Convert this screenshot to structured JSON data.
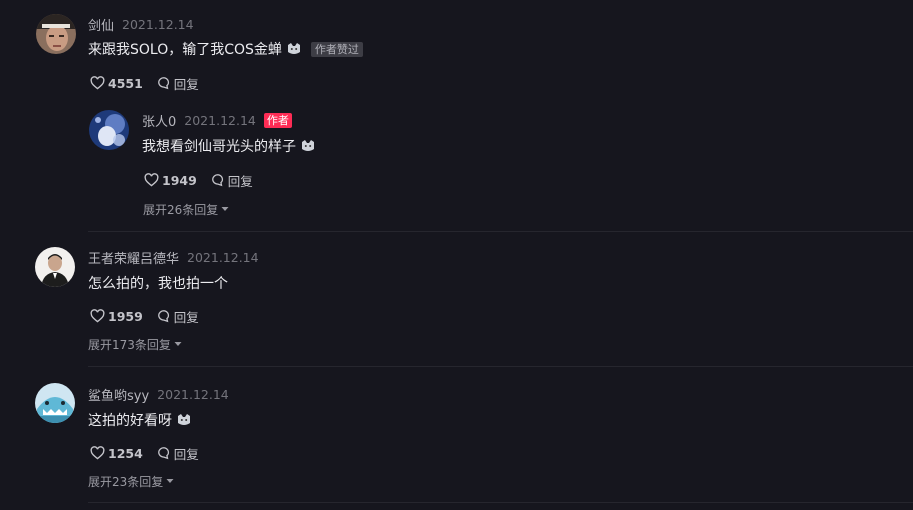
{
  "comments": [
    {
      "username": "剑仙",
      "date": "2021.12.14",
      "text": "来跟我SOLO，输了我COS金蝉",
      "liked_badge": "作者赞过",
      "likes": "4551",
      "reply_label": "回复",
      "reply": {
        "username": "张人0",
        "date": "2021.12.14",
        "author_badge": "作者",
        "text": "我想看剑仙哥光头的样子",
        "likes": "1949",
        "reply_label": "回复"
      },
      "expand_label": "展开26条回复"
    },
    {
      "username": "王者荣耀吕德华",
      "date": "2021.12.14",
      "text": "怎么拍的，我也拍一个",
      "likes": "1959",
      "reply_label": "回复",
      "expand_label": "展开173条回复"
    },
    {
      "username": "鲨鱼哟syy",
      "date": "2021.12.14",
      "text": "这拍的好看呀",
      "likes": "1254",
      "reply_label": "回复",
      "expand_label": "展开23条回复"
    }
  ],
  "colors": {
    "background": "#16161e",
    "author_badge": "#fe2c55"
  },
  "icons": [
    "heart-icon",
    "comment-bubble-icon",
    "chevron-down-icon",
    "cat-emoji-icon"
  ]
}
